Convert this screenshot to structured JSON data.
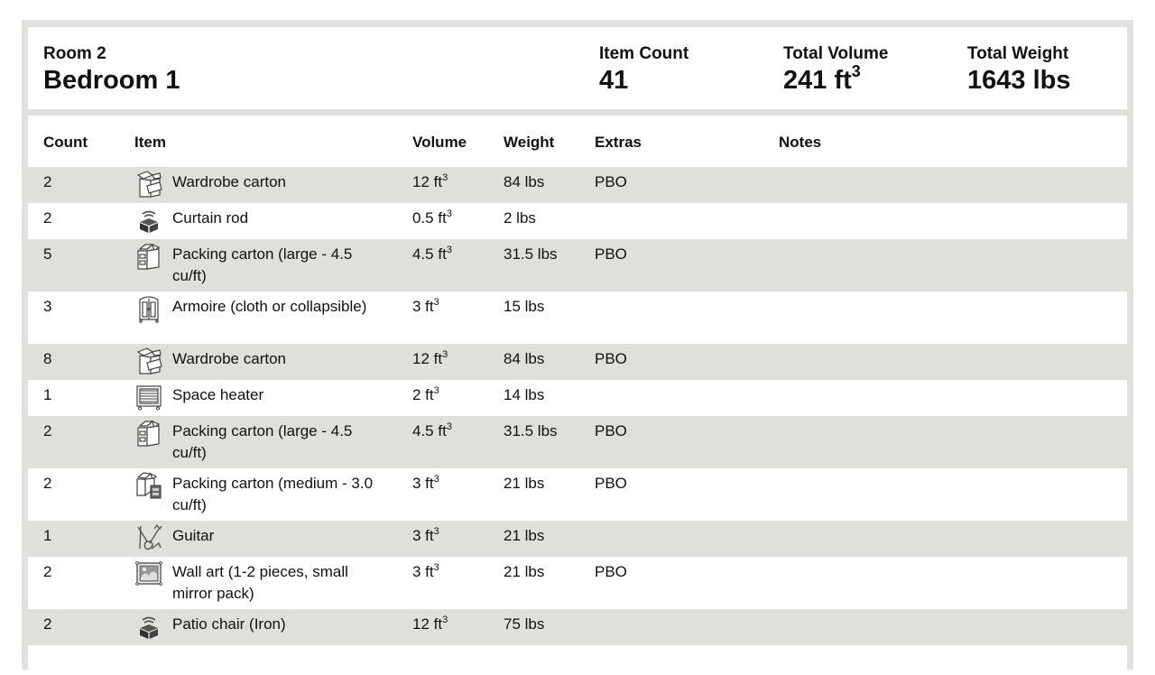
{
  "summary": {
    "room_label": "Room 2",
    "room_name": "Bedroom 1",
    "item_count_label": "Item Count",
    "item_count_value": "41",
    "total_volume_label": "Total Volume",
    "total_volume_value": "241 ft",
    "total_volume_unit_sup": "3",
    "total_weight_label": "Total Weight",
    "total_weight_value": "1643 lbs"
  },
  "table": {
    "headers": {
      "count": "Count",
      "item": "Item",
      "volume": "Volume",
      "weight": "Weight",
      "extras": "Extras",
      "notes": "Notes"
    },
    "volume_sup": "3",
    "rows": [
      {
        "count": "2",
        "icon": "wardrobe-carton-icon",
        "item": "Wardrobe carton",
        "volume": "12 ft",
        "weight": "84 lbs",
        "extras": "PBO",
        "notes": ""
      },
      {
        "count": "2",
        "icon": "generic-item-icon",
        "item": "Curtain rod",
        "volume": "0.5 ft",
        "weight": "2 lbs",
        "extras": "",
        "notes": ""
      },
      {
        "count": "5",
        "icon": "packing-carton-large-icon",
        "item": "Packing carton (large - 4.5 cu/ft)",
        "volume": "4.5 ft",
        "weight": "31.5 lbs",
        "extras": "PBO",
        "notes": ""
      },
      {
        "count": "3",
        "icon": "armoire-icon",
        "item": "Armoire (cloth or collapsible)",
        "volume": "3 ft",
        "weight": "15 lbs",
        "extras": "",
        "notes": ""
      },
      {
        "count": "8",
        "icon": "wardrobe-carton-icon",
        "item": "Wardrobe carton",
        "volume": "12 ft",
        "weight": "84 lbs",
        "extras": "PBO",
        "notes": ""
      },
      {
        "count": "1",
        "icon": "space-heater-icon",
        "item": "Space heater",
        "volume": "2 ft",
        "weight": "14 lbs",
        "extras": "",
        "notes": ""
      },
      {
        "count": "2",
        "icon": "packing-carton-large-icon",
        "item": "Packing carton (large - 4.5 cu/ft)",
        "volume": "4.5 ft",
        "weight": "31.5 lbs",
        "extras": "PBO",
        "notes": ""
      },
      {
        "count": "2",
        "icon": "packing-carton-medium-icon",
        "item": "Packing carton (medium - 3.0 cu/ft)",
        "volume": "3 ft",
        "weight": "21 lbs",
        "extras": "PBO",
        "notes": ""
      },
      {
        "count": "1",
        "icon": "guitar-icon",
        "item": "Guitar",
        "volume": "3 ft",
        "weight": "21 lbs",
        "extras": "",
        "notes": ""
      },
      {
        "count": "2",
        "icon": "wall-art-icon",
        "item": "Wall art (1-2 pieces, small mirror pack)",
        "volume": "3 ft",
        "weight": "21 lbs",
        "extras": "PBO",
        "notes": ""
      },
      {
        "count": "2",
        "icon": "generic-item-icon",
        "item": "Patio chair (Iron)",
        "volume": "12 ft",
        "weight": "75 lbs",
        "extras": "",
        "notes": ""
      }
    ]
  },
  "colors": {
    "frame": "#e0e0dc",
    "row_shade": "#dfdfdb",
    "text": "#111111"
  }
}
